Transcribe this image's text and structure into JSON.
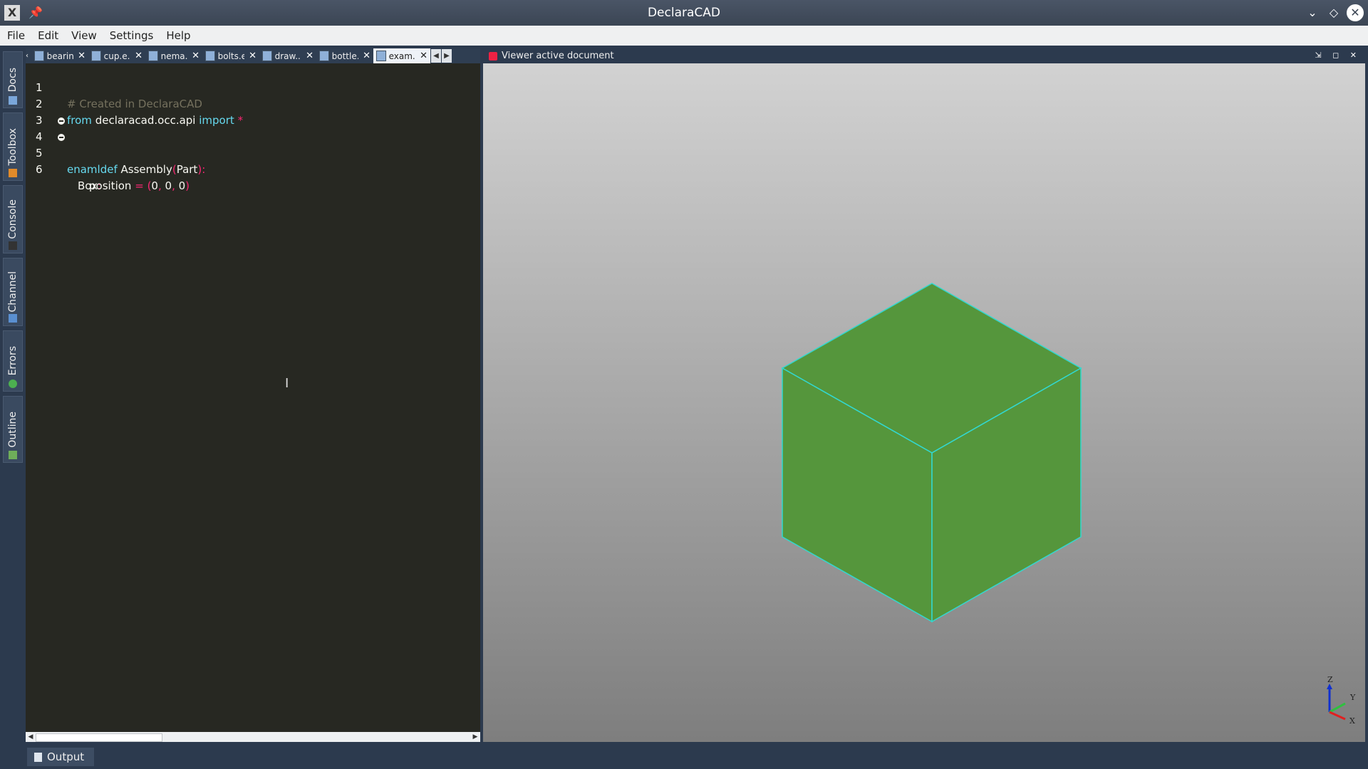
{
  "window": {
    "title": "DeclaraCAD",
    "app_icon_glyph": "X",
    "pin_glyph": "📌"
  },
  "menu": [
    "File",
    "Edit",
    "View",
    "Settings",
    "Help"
  ],
  "left_dock": [
    {
      "label": "Docs",
      "icon": "docs-icon",
      "color": "#7aa6d9"
    },
    {
      "label": "Toolbox",
      "icon": "toolbox-icon",
      "color": "#e08a2a"
    },
    {
      "label": "Console",
      "icon": "console-icon",
      "color": "#333333"
    },
    {
      "label": "Channel",
      "icon": "channel-icon",
      "color": "#5a8fd0"
    },
    {
      "label": "Errors",
      "icon": "errors-icon",
      "color": "#4caf50"
    },
    {
      "label": "Outline",
      "icon": "outline-icon",
      "color": "#6fae5a"
    }
  ],
  "editor": {
    "tabs": [
      {
        "name": "bearin..",
        "active": false
      },
      {
        "name": "cup.e..",
        "active": false
      },
      {
        "name": "nema..",
        "active": false
      },
      {
        "name": "bolts.e..",
        "active": false
      },
      {
        "name": "draw...",
        "active": false
      },
      {
        "name": "bottle...",
        "active": false
      },
      {
        "name": "exam..",
        "active": true
      }
    ],
    "lines": [
      {
        "num": "1",
        "comment": "# Created in DeclaraCAD"
      },
      {
        "num": "2",
        "kw1": "from",
        "mod": "declaracad.occ.api",
        "kw2": "import",
        "star": "*"
      },
      {
        "num": "3"
      },
      {
        "num": "4",
        "kw": "enamldef",
        "name": "Assembly",
        "paren_open": "(",
        "base": "Part",
        "paren_close": ")",
        "colon": ":"
      },
      {
        "num": "5",
        "name": "Box",
        "colon": ":"
      },
      {
        "num": "6",
        "attr": "position",
        "eq": "=",
        "tuple_open": "(",
        "v1": "0",
        "v2": "0",
        "v3": "0",
        "tuple_close": ")"
      }
    ]
  },
  "viewer": {
    "title": "Viewer active document",
    "ctrls": "⇲ ◻ ✕",
    "cube_color": "#55963c",
    "edge_color": "#32d8d0",
    "axes": {
      "z": "Z",
      "y": "Y",
      "x": "X"
    }
  },
  "bottom": {
    "output_label": "Output"
  }
}
